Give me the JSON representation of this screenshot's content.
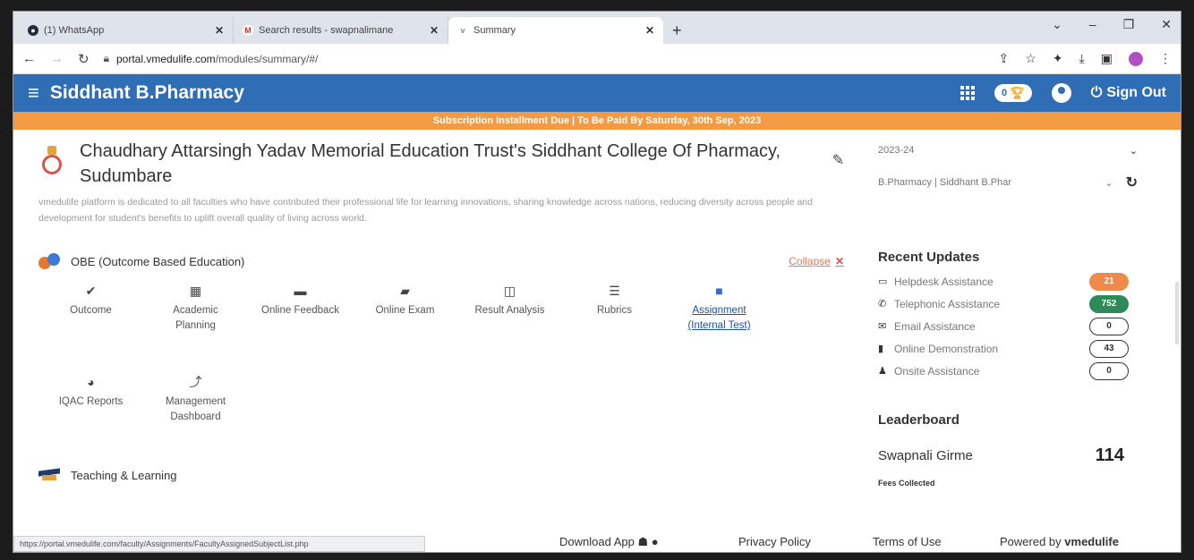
{
  "browser": {
    "tabs": [
      {
        "label": "(1) WhatsApp",
        "icon": "whatsapp-icon",
        "color": "#1f2d3d"
      },
      {
        "label": "Search results - swapnalimane",
        "icon": "gmail-icon",
        "color": "#d93025"
      },
      {
        "label": "Summary",
        "icon": "vmedulife-icon",
        "color": "#888888"
      }
    ],
    "new_tab": "+",
    "url_host": "portal.vmedulife.com",
    "url_path": "/modules/summary/#/"
  },
  "app": {
    "brand": "Siddhant B.Pharmacy",
    "toggle_value": "0",
    "signout_label": "Sign Out",
    "notice": "Subscription Installment Due | To Be Paid By Saturday, 30th Sep, 2023",
    "accent": "#2f6db4",
    "notice_color": "#f39a45"
  },
  "institute": {
    "name": "Chaudhary Attarsingh Yadav Memorial Education Trust's Siddhant College Of Pharmacy, Sudumbare",
    "description": "vmedulife platform is dedicated to all faculties who have contributed their professional life for learning innovations, sharing knowledge across nations, reducing diversity across people and development for student's benefits to uplift overall quality of living across world."
  },
  "obe": {
    "title": "OBE (Outcome Based Education)",
    "collapse_label": "Collapse",
    "tiles": [
      {
        "label": "Outcome",
        "icon": "check-double-icon",
        "glyph": "✔"
      },
      {
        "label": "Academic Planning",
        "icon": "calendar-icon",
        "glyph": "▦"
      },
      {
        "label": "Online Feedback",
        "icon": "chat-icon",
        "glyph": "▬"
      },
      {
        "label": "Online Exam",
        "icon": "folder-icon",
        "glyph": "▰"
      },
      {
        "label": "Result Analysis",
        "icon": "chart-icon",
        "glyph": "◫"
      },
      {
        "label": "Rubrics",
        "icon": "list-icon",
        "glyph": "☰"
      },
      {
        "label": "Assignment (Internal Test)",
        "icon": "assignment-icon",
        "glyph": "■"
      },
      {
        "label": "IQAC Reports",
        "icon": "pie-chart-icon",
        "glyph": "◕"
      },
      {
        "label": "Management Dashboard",
        "icon": "trend-icon",
        "glyph": "⤴"
      }
    ]
  },
  "teaching": {
    "title": "Teaching & Learning"
  },
  "filters": {
    "year": "2023-24",
    "program": "B.Pharmacy | Siddhant B.Phar"
  },
  "recent_updates": {
    "title": "Recent Updates",
    "items": [
      {
        "label": "Helpdesk Assistance",
        "count": "21",
        "style": "orange",
        "icon": "chat-icon",
        "glyph": "▭"
      },
      {
        "label": "Telephonic Assistance",
        "count": "752",
        "style": "green",
        "icon": "phone-icon",
        "glyph": "✆"
      },
      {
        "label": "Email Assistance",
        "count": "0",
        "style": "outline",
        "icon": "email-icon",
        "glyph": "✉"
      },
      {
        "label": "Online Demonstration",
        "count": "43",
        "style": "outline",
        "icon": "video-icon",
        "glyph": "▮"
      },
      {
        "label": "Onsite Assistance",
        "count": "0",
        "style": "outline",
        "icon": "users-icon",
        "glyph": "♟"
      }
    ]
  },
  "leaderboard": {
    "title": "Leaderboard",
    "name": "Swapnali Girme",
    "score": "114",
    "fees_label": "Fees Collected"
  },
  "footer": {
    "status_url": "https://portal.vmedulife.com/faculty/Assignments/FacultyAssignedSubjectList.php",
    "download_app": "Download App",
    "privacy": "Privacy Policy",
    "terms": "Terms of Use",
    "powered": "Powered by",
    "powered_brand": "vmedulife"
  }
}
